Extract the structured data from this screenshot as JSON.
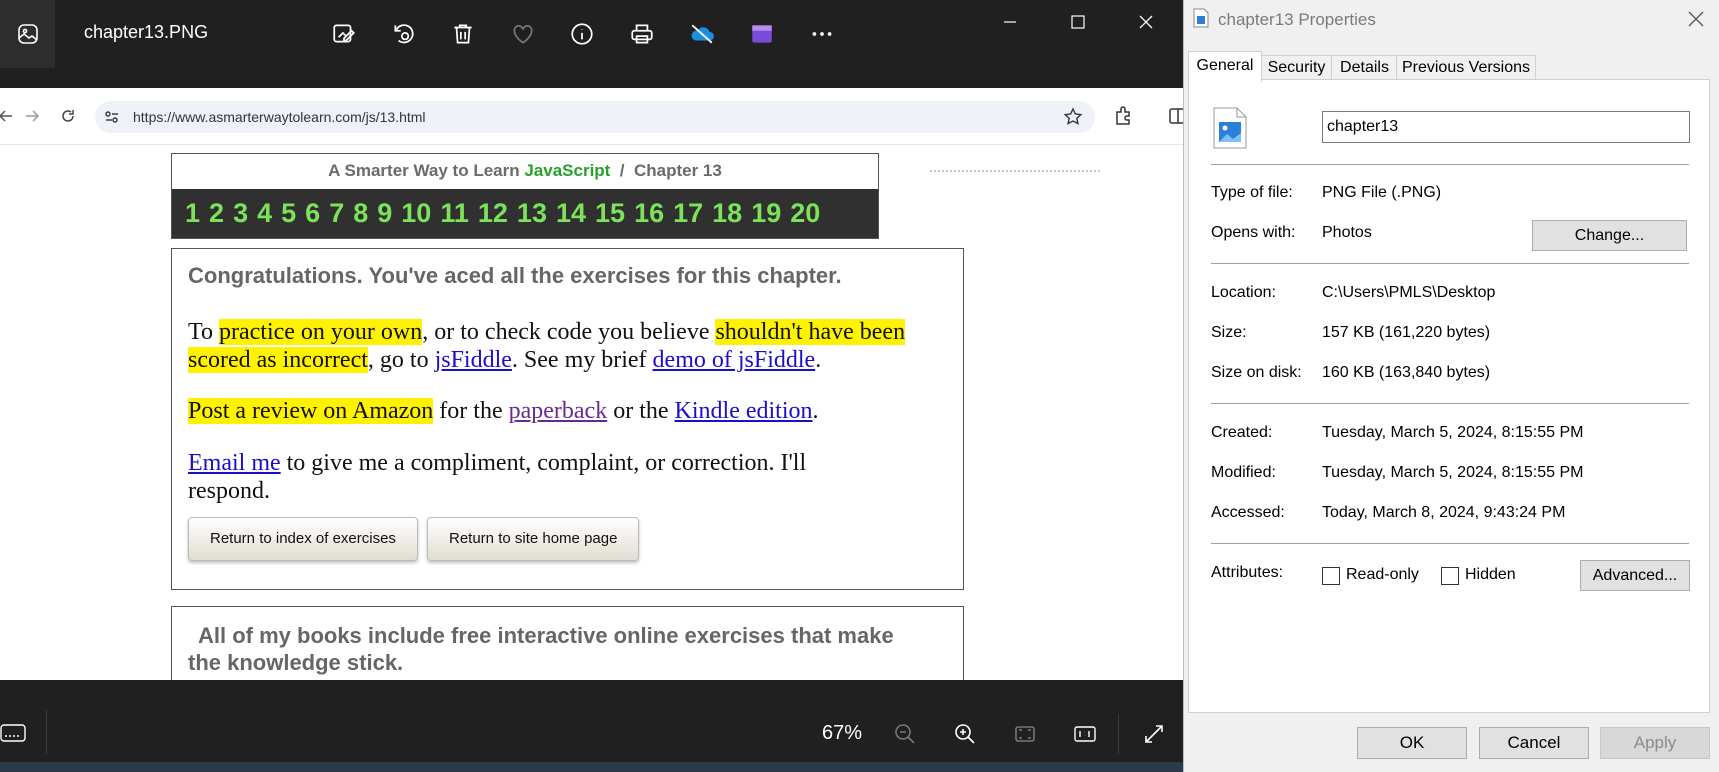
{
  "viewer": {
    "file_title": "chapter13.PNG",
    "zoom": "67%",
    "toolbar_icons": [
      "edit-image-icon",
      "rotate-icon",
      "delete-icon",
      "favorite-icon",
      "info-icon",
      "print-icon",
      "onedrive-icon",
      "clipchamp-icon",
      "more-icon"
    ]
  },
  "browser": {
    "url": "https://www.asmarterwaytolearn.com/js/13.html"
  },
  "page": {
    "crumb_prefix": "A Smarter Way to Learn ",
    "crumb_js": "JavaScript",
    "crumb_suffix": "  /  Chapter 13",
    "chapters": [
      "1",
      "2",
      "3",
      "4",
      "5",
      "6",
      "7",
      "8",
      "9",
      "10",
      "11",
      "12",
      "13",
      "14",
      "15",
      "16",
      "17",
      "18",
      "19",
      "20"
    ],
    "congrats": "Congratulations. You've aced all the exercises for this chapter.",
    "p1_a": "To ",
    "p1_hl1": "practice on your own",
    "p1_b": ", or to check code you believe ",
    "p1_hl2": "shouldn't have been scored as incorrect",
    "p1_c": ", go to ",
    "p1_link1": "jsFiddle",
    "p1_d": ". See my brief ",
    "p1_link2": "demo of jsFiddle",
    "p1_e": ".",
    "p2_hl": "Post a review on Amazon",
    "p2_a": " for the ",
    "p2_link1": "paperback",
    "p2_b": " or the ",
    "p2_link2": "Kindle edition",
    "p2_c": ".",
    "p3_link": "Email me",
    "p3_a": " to give me a compliment, complaint, or correction. I'll respond.",
    "btn_index": "Return to index of exercises",
    "btn_home": "Return to site home page",
    "books": "All of my books include free interactive online exercises that make the knowledge stick."
  },
  "props": {
    "title": "chapter13 Properties",
    "tabs": [
      "General",
      "Security",
      "Details",
      "Previous Versions"
    ],
    "file_name": "chapter13",
    "type_label": "Type of file:",
    "type_value": "PNG File (.PNG)",
    "opens_label": "Opens with:",
    "opens_value": "Photos",
    "change_btn": "Change...",
    "location_label": "Location:",
    "location_value": "C:\\Users\\PMLS\\Desktop",
    "size_label": "Size:",
    "size_value": "157 KB (161,220 bytes)",
    "size_disk_label": "Size on disk:",
    "size_disk_value": "160 KB (163,840 bytes)",
    "created_label": "Created:",
    "created_value": "Tuesday, March 5, 2024, 8:15:55 PM",
    "modified_label": "Modified:",
    "modified_value": "Tuesday, March 5, 2024, 8:15:55 PM",
    "accessed_label": "Accessed:",
    "accessed_value": "Today, March 8, 2024, 9:43:24 PM",
    "attr_label": "Attributes:",
    "readonly_label": "Read-only",
    "hidden_label": "Hidden",
    "advanced_btn": "Advanced...",
    "ok": "OK",
    "cancel": "Cancel",
    "apply": "Apply"
  },
  "colors": {
    "viewer_bg": "#202020",
    "chapter_num": "#7ce25a",
    "highlight": "#fff200",
    "link": "#1a0dcc",
    "link_visited": "#6a2a8a"
  }
}
